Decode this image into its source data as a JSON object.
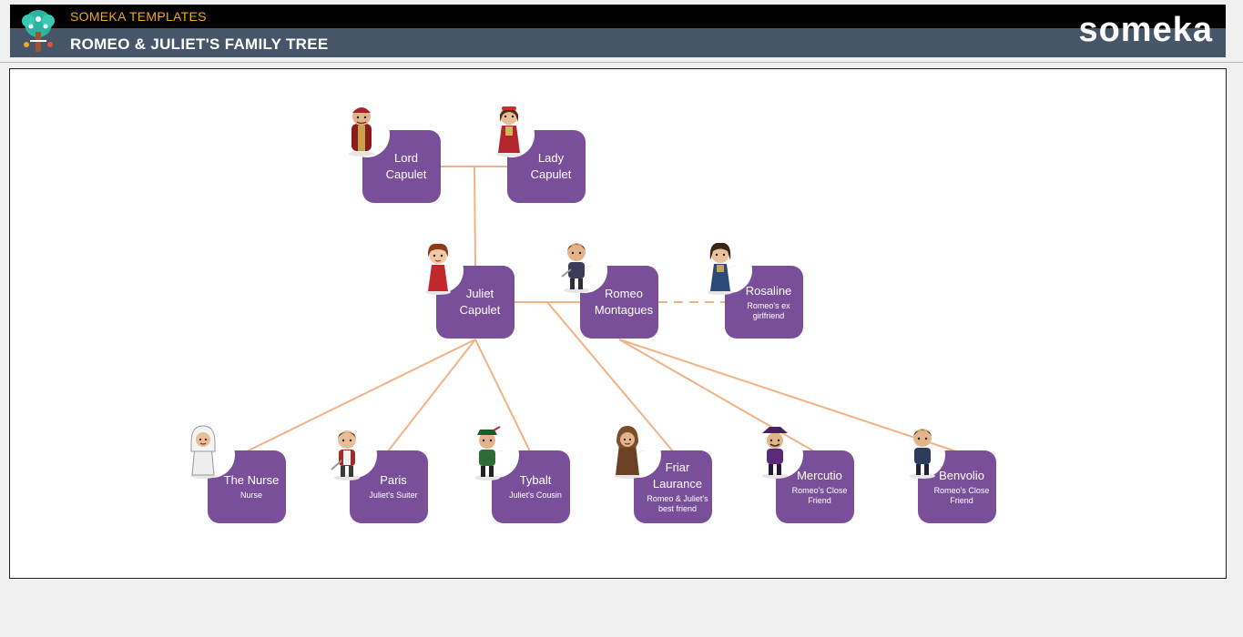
{
  "header": {
    "subtitle": "SOMEKA TEMPLATES",
    "title": "ROMEO & JULIET'S FAMILY TREE",
    "brand": "someka"
  },
  "colors": {
    "card": "#7a4f9a",
    "link": "#f4b183",
    "header_bg": "#475569",
    "subtitle": "#f5a623"
  },
  "people": {
    "lord_capulet": {
      "name": "Lord Capulet",
      "role": ""
    },
    "lady_capulet": {
      "name": "Lady Capulet",
      "role": ""
    },
    "juliet": {
      "name": "Juliet Capulet",
      "role": ""
    },
    "romeo": {
      "name": "Romeo Montagues",
      "role": ""
    },
    "rosaline": {
      "name": "Rosaline",
      "role": "Romeo's ex girlfriend"
    },
    "nurse": {
      "name": "The Nurse",
      "role": "Nurse"
    },
    "paris": {
      "name": "Paris",
      "role": "Juliet's Suiter"
    },
    "tybalt": {
      "name": "Tybalt",
      "role": "Juliet's Cousin"
    },
    "friar_laurance": {
      "name": "Friar Laurance",
      "role": "Romeo & Juliet's best friend"
    },
    "mercutio": {
      "name": "Mercutio",
      "role": "Romeo's Close Friend"
    },
    "benvolio": {
      "name": "Benvolio",
      "role": "Romeo's Close Friend"
    }
  },
  "icons": {
    "logo": "family-tree-icon",
    "avatars": "character-portrait-icon"
  }
}
